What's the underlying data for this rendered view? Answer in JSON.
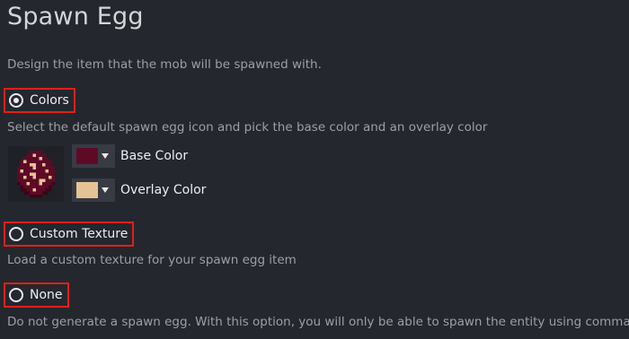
{
  "header": {
    "title": "Spawn Egg",
    "description": "Design the item that the mob will be spawned with."
  },
  "options": {
    "colors": {
      "label": "Colors",
      "checked": true,
      "description": "Select the default spawn egg icon and pick the base color and an overlay color"
    },
    "custom_texture": {
      "label": "Custom Texture",
      "checked": false,
      "description": "Load a custom texture for your spawn egg item"
    },
    "none": {
      "label": "None",
      "checked": false,
      "description": "Do not generate a spawn egg. With this option, you will only be able to spawn the entity using commands."
    }
  },
  "colors": {
    "base": {
      "label": "Base Color",
      "value": "#5e0a26"
    },
    "overlay": {
      "label": "Overlay Color",
      "value": "#e6c396"
    }
  },
  "theme": {
    "background": "#25272e",
    "highlight_border": "#e0201a"
  },
  "icons": [
    "radio-selected",
    "radio-unselected",
    "dropdown-caret",
    "spawn-egg"
  ]
}
